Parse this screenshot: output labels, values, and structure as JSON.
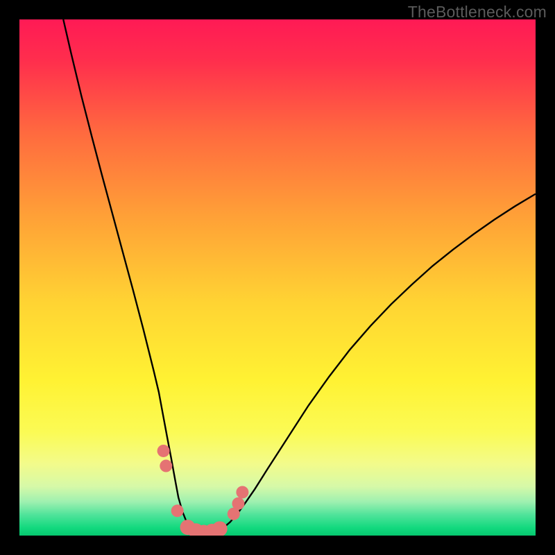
{
  "watermark": "TheBottleneck.com",
  "frame": {
    "bg": "#000000",
    "inset": 28
  },
  "chart_data": {
    "type": "line",
    "title": "",
    "xlabel": "",
    "ylabel": "",
    "x_range": [
      0,
      100
    ],
    "y_range": [
      0,
      100
    ],
    "background_gradient_stops": [
      {
        "offset": 0.0,
        "color": "#ff1a55"
      },
      {
        "offset": 0.08,
        "color": "#ff2e4d"
      },
      {
        "offset": 0.22,
        "color": "#ff6a3f"
      },
      {
        "offset": 0.38,
        "color": "#ffa037"
      },
      {
        "offset": 0.55,
        "color": "#ffd433"
      },
      {
        "offset": 0.7,
        "color": "#fff233"
      },
      {
        "offset": 0.8,
        "color": "#fbfb55"
      },
      {
        "offset": 0.86,
        "color": "#f3fb8a"
      },
      {
        "offset": 0.905,
        "color": "#d6f9a8"
      },
      {
        "offset": 0.935,
        "color": "#9df0b0"
      },
      {
        "offset": 0.96,
        "color": "#4fe39a"
      },
      {
        "offset": 0.985,
        "color": "#12d97e"
      },
      {
        "offset": 1.0,
        "color": "#07c86f"
      }
    ],
    "series": [
      {
        "name": "bottleneck-curve",
        "color": "#000000",
        "stroke_width": 2.4,
        "x": [
          8.5,
          10,
          12,
          14,
          16,
          18,
          20,
          22,
          24,
          25,
          26,
          27,
          27.8,
          28.6,
          29.4,
          30.2,
          30.8,
          31.6,
          32.4,
          33.4,
          34.4,
          35.6,
          36.8,
          38.0,
          39.4,
          40.8,
          42.2,
          43.8,
          45.6,
          48,
          52,
          56,
          60,
          64,
          68,
          72,
          76,
          80,
          84,
          88,
          92,
          96,
          100
        ],
        "y": [
          100,
          93.5,
          85.2,
          77.4,
          69.8,
          62.4,
          55.0,
          47.6,
          40.0,
          36.0,
          32.0,
          27.8,
          23.5,
          19.2,
          15.0,
          10.6,
          7.4,
          4.6,
          2.6,
          1.4,
          0.8,
          0.6,
          0.6,
          0.8,
          1.4,
          2.6,
          4.2,
          6.4,
          9.0,
          12.8,
          19.0,
          25.2,
          30.8,
          36.0,
          40.6,
          44.8,
          48.6,
          52.2,
          55.4,
          58.4,
          61.2,
          63.8,
          66.2
        ]
      }
    ],
    "markers": {
      "name": "highlighted-points",
      "color": "#e57373",
      "radius_small": 9,
      "radius_large": 11,
      "points": [
        {
          "x": 27.9,
          "y": 16.4,
          "r": "s"
        },
        {
          "x": 28.4,
          "y": 13.5,
          "r": "s"
        },
        {
          "x": 30.6,
          "y": 4.8,
          "r": "s"
        },
        {
          "x": 32.6,
          "y": 1.6,
          "r": "l"
        },
        {
          "x": 34.2,
          "y": 0.9,
          "r": "l"
        },
        {
          "x": 35.7,
          "y": 0.6,
          "r": "l"
        },
        {
          "x": 37.3,
          "y": 0.8,
          "r": "l"
        },
        {
          "x": 38.8,
          "y": 1.3,
          "r": "l"
        },
        {
          "x": 41.5,
          "y": 4.2,
          "r": "s"
        },
        {
          "x": 42.4,
          "y": 6.2,
          "r": "s"
        },
        {
          "x": 43.2,
          "y": 8.4,
          "r": "s"
        }
      ]
    }
  }
}
